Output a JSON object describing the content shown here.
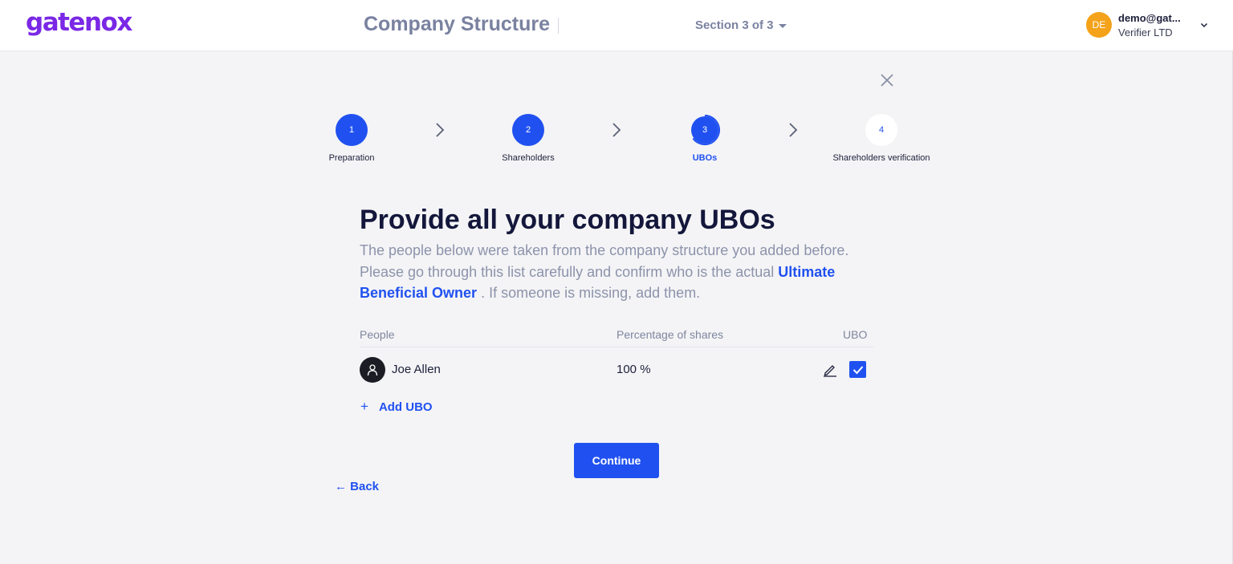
{
  "header": {
    "logo_text": "gatenox",
    "page_title": "Company Structure",
    "section_label": "Section 3 of 3",
    "user": {
      "initials": "DE",
      "email": "demo@gat...",
      "company": "Verifier LTD"
    },
    "colors": {
      "brand": "#7a28e6",
      "avatar": "#f4a21a"
    }
  },
  "stepper": {
    "steps": [
      {
        "number": "1",
        "label": "Preparation",
        "state": "completed"
      },
      {
        "number": "2",
        "label": "Shareholders",
        "state": "completed"
      },
      {
        "number": "3",
        "label": "UBOs",
        "state": "current"
      },
      {
        "number": "4",
        "label": "Shareholders verification",
        "state": "pending"
      }
    ],
    "colors": {
      "accent": "#2051f0"
    }
  },
  "content": {
    "heading": "Provide all your company UBOs",
    "intro_part1": "The people below were taken from the company structure you added before. Please go through this list carefully and confirm who is the actual ",
    "intro_link": "Ultimate Beneficial Owner",
    "intro_part2": " . If someone is missing, add them."
  },
  "table": {
    "columns": {
      "people": "People",
      "shares": "Percentage of shares",
      "ubo": "UBO"
    },
    "rows": [
      {
        "name": "Joe Allen",
        "shares": "100 %",
        "is_ubo": true
      }
    ],
    "add_label": "Add UBO"
  },
  "actions": {
    "continue_label": "Continue",
    "back_label": "← Back"
  }
}
